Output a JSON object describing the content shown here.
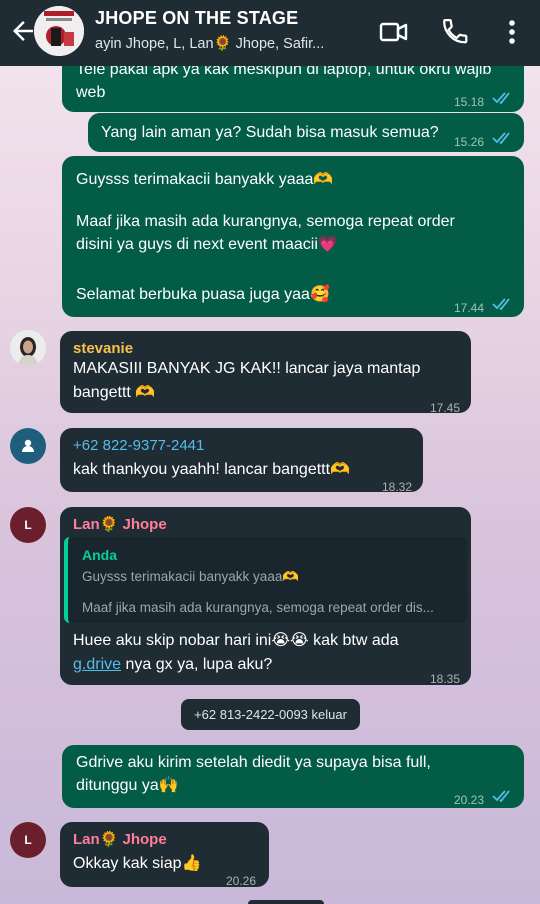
{
  "header": {
    "title": "JHOPE ON THE STAGE",
    "subtitle": "ayin Jhope, L, Lan🌻 Jhope, Safir...",
    "back_icon": "arrow-left-icon",
    "video_icon": "video-call-icon",
    "call_icon": "phone-icon",
    "menu_icon": "more-vert-icon",
    "background": "#1f2c34"
  },
  "colors": {
    "outgoing_bubble": "#035c45",
    "incoming_bubble": "#202c33",
    "read_tick": "#53bdeb",
    "sender_pink": "#ff7e9c",
    "sender_yellow": "#f7c14d",
    "sender_blue": "#53bdeb"
  },
  "messages": [
    {
      "id": "m1",
      "direction": "out",
      "text_line1": "Tele pakai apk ya kak meskipun di laptop, untuk okru wajib",
      "text_line2": "web",
      "time": "15.18",
      "status": "read"
    },
    {
      "id": "m2",
      "direction": "out",
      "text": "Yang lain aman ya? Sudah bisa masuk semua?",
      "time": "15.26",
      "status": "read"
    },
    {
      "id": "m3",
      "direction": "out",
      "para1": "Guysss terimakacii banyakk yaaa🫶",
      "para2_line1": "Maaf jika masih ada kurangnya, semoga repeat order",
      "para2_line2": "disini ya guys di next event maacii💗",
      "para3": "Selamat berbuka puasa juga yaa🥰",
      "time": "17.44",
      "status": "read"
    },
    {
      "id": "m4",
      "direction": "in",
      "sender": "stevanie",
      "text_line1": "MAKASIII BANYAK JG KAK!! lancar jaya mantap",
      "text_line2": "bangettt 🫶",
      "time": "17.45"
    },
    {
      "id": "m5",
      "direction": "in",
      "sender": "+62 822-9377-2441",
      "text": "kak thankyou yaahh! lancar bangettt🫶",
      "time": "18.32"
    },
    {
      "id": "m6",
      "direction": "in",
      "sender": "Lan🌻 Jhope",
      "avatar_letter": "L",
      "quote_author": "Anda",
      "quote_line1": "Guysss terimakacii banyakk yaaa🫶",
      "quote_line2": "Maaf jika masih ada kurangnya, semoga repeat order dis...",
      "text_line1": "Huee aku skip nobar hari ini😭😭 kak btw ada",
      "link": "g.drive",
      "text_line2_rest": " nya gx ya, lupa aku?",
      "time": "18.35"
    },
    {
      "id": "sys1",
      "direction": "system",
      "text": "+62 813-2422-0093 keluar"
    },
    {
      "id": "m7",
      "direction": "out",
      "text_line1": "Gdrive aku kirim setelah diedit ya supaya bisa full,",
      "text_line2": "ditunggu ya🙌",
      "time": "20.23",
      "status": "read"
    },
    {
      "id": "m8",
      "direction": "in",
      "sender": "Lan🌻 Jhope",
      "avatar_letter": "L",
      "text": "Okkay kak siap👍",
      "time": "20.26"
    }
  ]
}
